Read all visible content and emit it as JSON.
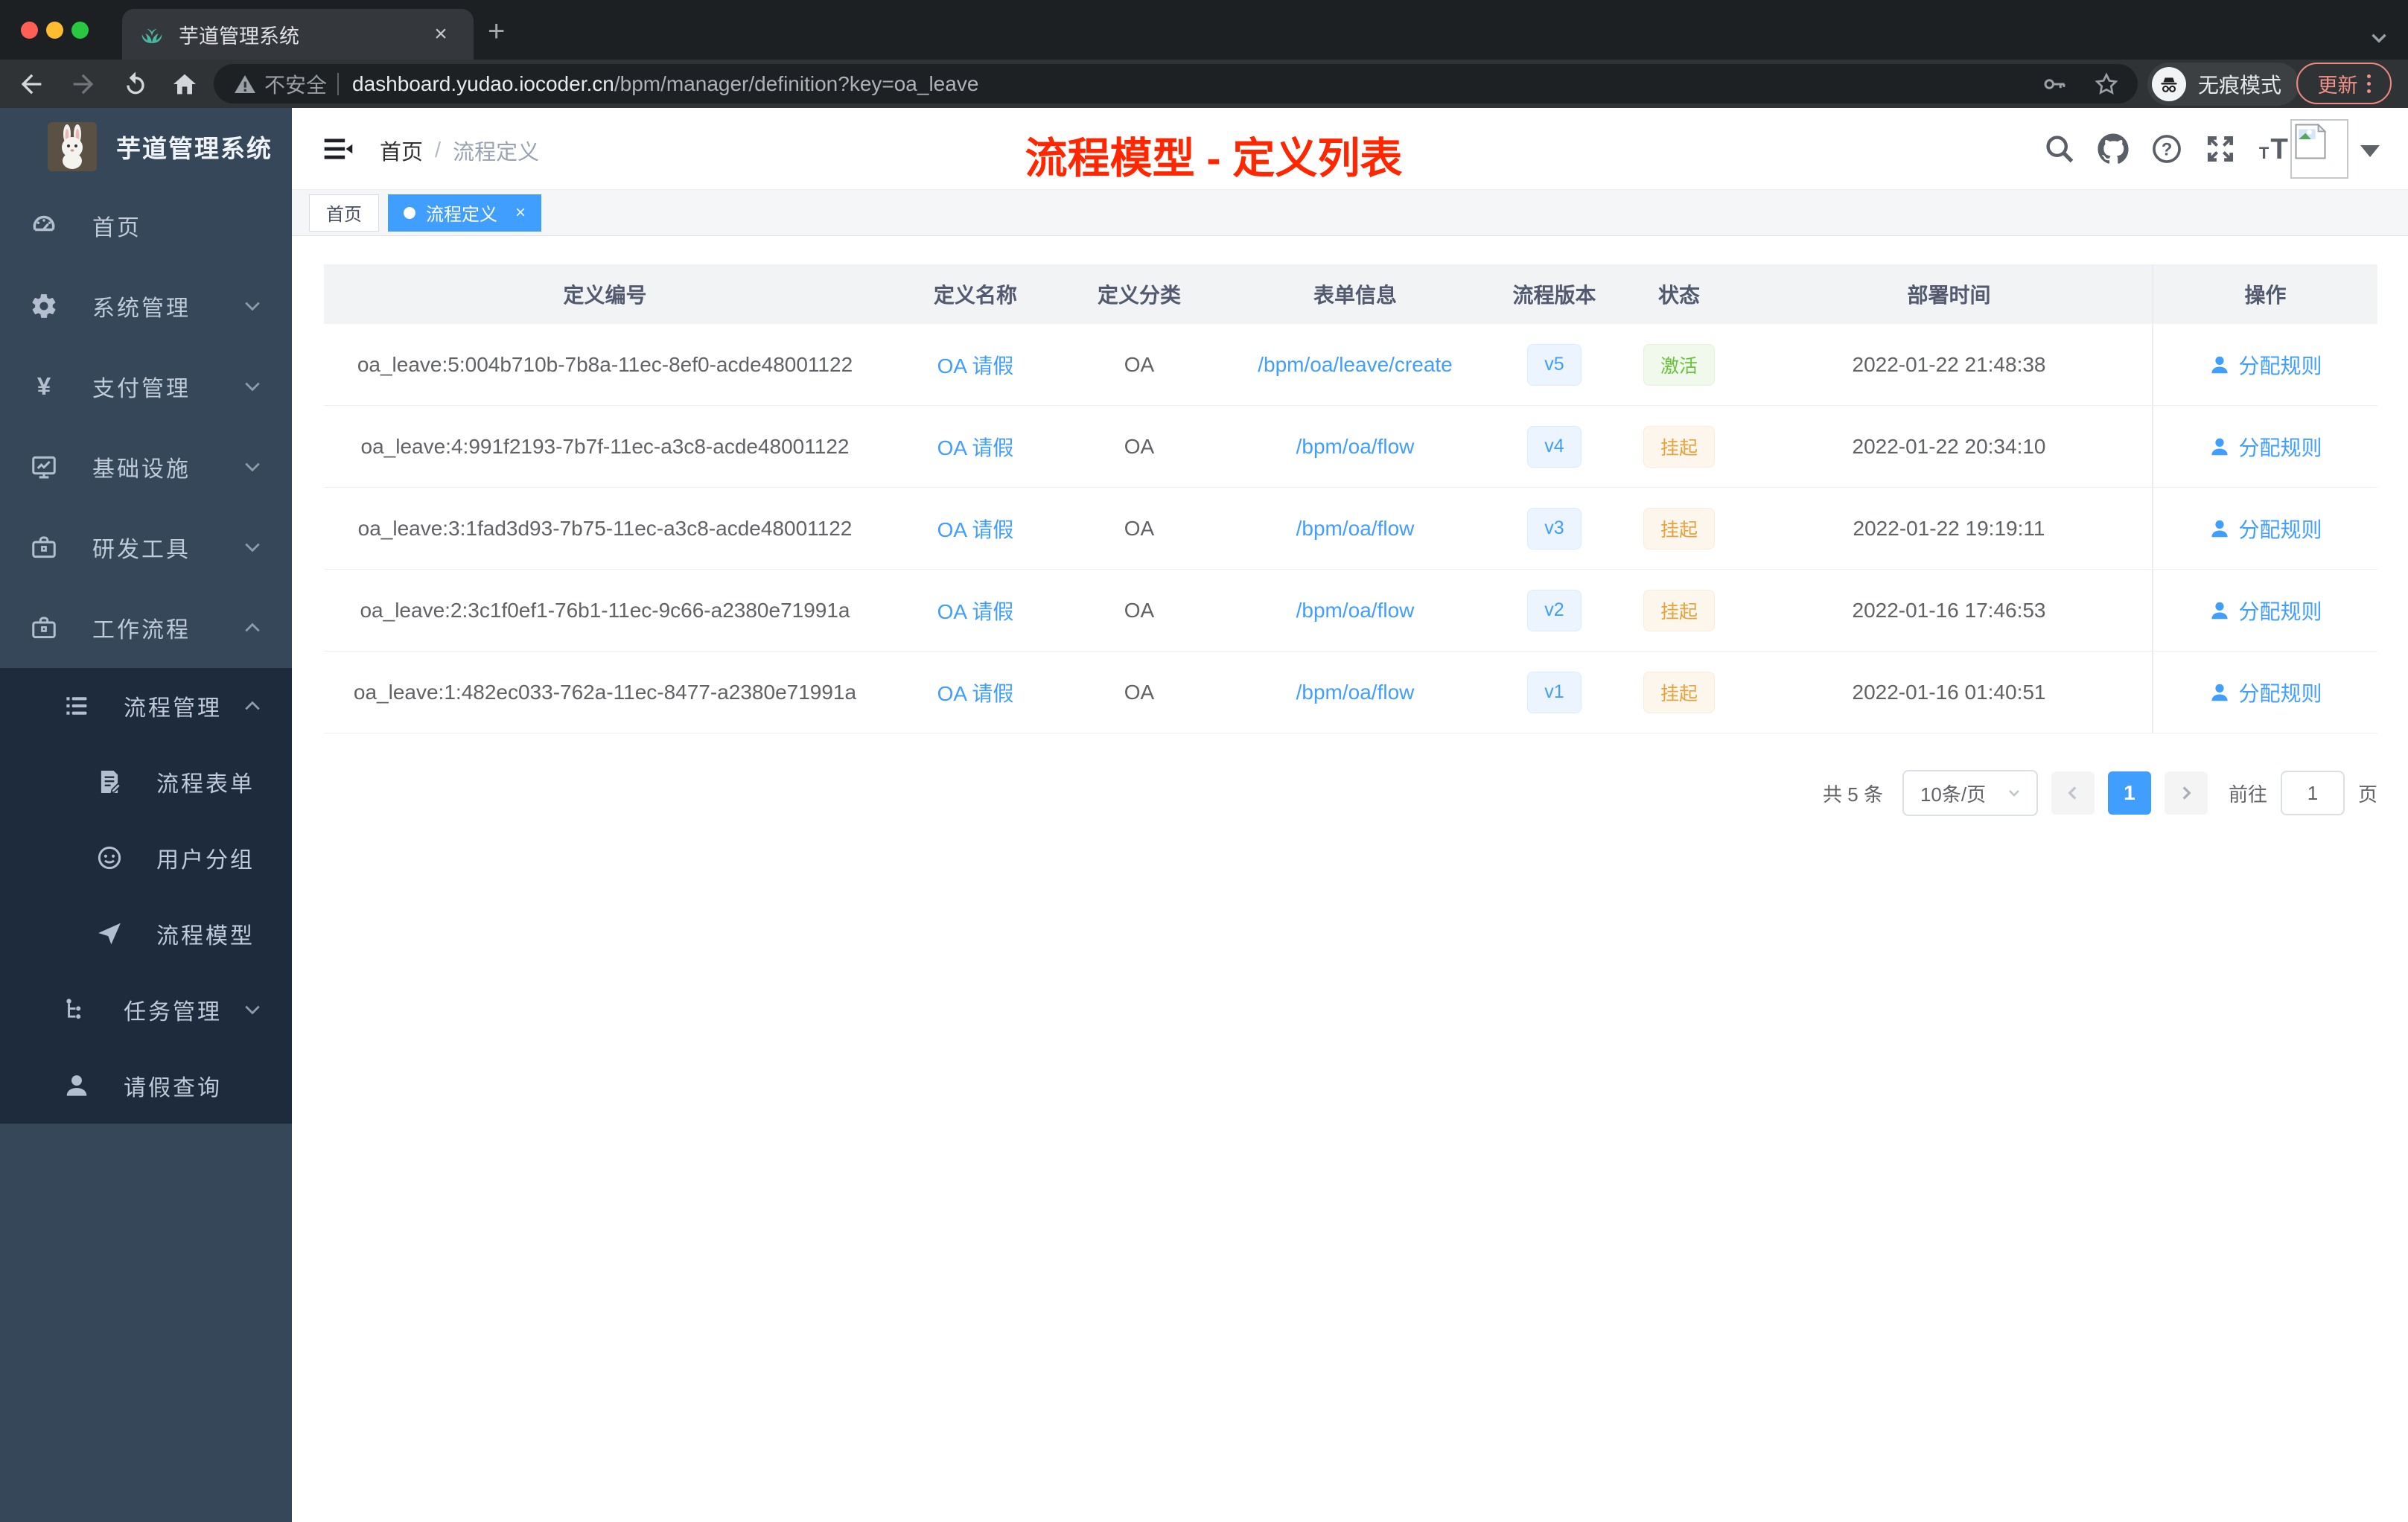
{
  "browser": {
    "tab_title": "芋道管理系统",
    "security_label": "不安全",
    "url_domain": "dashboard.yudao.iocoder.cn",
    "url_path": "/bpm/manager/definition?key=oa_leave",
    "incognito_label": "无痕模式",
    "update_label": "更新"
  },
  "sidebar": {
    "logo_title": "芋道管理系统",
    "items": [
      {
        "key": "home",
        "label": "首页",
        "icon": "dashboard-icon",
        "level": 1,
        "chevron": "",
        "submenu": false
      },
      {
        "key": "system-management",
        "label": "系统管理",
        "icon": "gear-icon",
        "level": 1,
        "chevron": "down",
        "submenu": false
      },
      {
        "key": "payment-management",
        "label": "支付管理",
        "icon": "yen-icon",
        "level": 1,
        "chevron": "down",
        "submenu": false
      },
      {
        "key": "infrastructure",
        "label": "基础设施",
        "icon": "monitor-icon",
        "level": 1,
        "chevron": "down",
        "submenu": false
      },
      {
        "key": "dev-tools",
        "label": "研发工具",
        "icon": "toolbox-icon",
        "level": 1,
        "chevron": "down",
        "submenu": false
      },
      {
        "key": "workflow",
        "label": "工作流程",
        "icon": "toolbox-icon",
        "level": 1,
        "chevron": "up",
        "submenu": false
      },
      {
        "key": "process-management",
        "label": "流程管理",
        "icon": "list-icon",
        "level": 2,
        "chevron": "up",
        "submenu": true
      },
      {
        "key": "process-form",
        "label": "流程表单",
        "icon": "form-icon",
        "level": 3,
        "chevron": "",
        "submenu": true
      },
      {
        "key": "user-group",
        "label": "用户分组",
        "icon": "user-group-icon",
        "level": 3,
        "chevron": "",
        "submenu": true
      },
      {
        "key": "process-model",
        "label": "流程模型",
        "icon": "paper-plane-icon",
        "level": 3,
        "chevron": "",
        "submenu": true
      },
      {
        "key": "task-management",
        "label": "任务管理",
        "icon": "tree-icon",
        "level": 2,
        "chevron": "down",
        "submenu": true
      },
      {
        "key": "leave-query",
        "label": "请假查询",
        "icon": "person-icon",
        "level": 2,
        "chevron": "",
        "submenu": true
      }
    ]
  },
  "navbar": {
    "breadcrumb_home": "首页",
    "breadcrumb_separator": "/",
    "breadcrumb_current": "流程定义",
    "annotation": "流程模型 - 定义列表",
    "icons": [
      {
        "key": "search"
      },
      {
        "key": "github"
      },
      {
        "key": "question"
      },
      {
        "key": "fullscreen"
      },
      {
        "key": "font-size"
      }
    ]
  },
  "tags": [
    {
      "label": "首页",
      "active": false,
      "closable": false
    },
    {
      "label": "流程定义",
      "active": true,
      "closable": true
    }
  ],
  "table": {
    "headers": [
      "定义编号",
      "定义名称",
      "定义分类",
      "表单信息",
      "流程版本",
      "状态",
      "部署时间",
      "操作"
    ],
    "rows": [
      {
        "id": "oa_leave:5:004b710b-7b8a-11ec-8ef0-acde48001122",
        "name": "OA 请假",
        "category": "OA",
        "form": "/bpm/oa/leave/create",
        "version": "v5",
        "status": "激活",
        "status_type": "success",
        "deploy_time": "2022-01-22 21:48:38",
        "action": "分配规则"
      },
      {
        "id": "oa_leave:4:991f2193-7b7f-11ec-a3c8-acde48001122",
        "name": "OA 请假",
        "category": "OA",
        "form": "/bpm/oa/flow",
        "version": "v4",
        "status": "挂起",
        "status_type": "warning",
        "deploy_time": "2022-01-22 20:34:10",
        "action": "分配规则"
      },
      {
        "id": "oa_leave:3:1fad3d93-7b75-11ec-a3c8-acde48001122",
        "name": "OA 请假",
        "category": "OA",
        "form": "/bpm/oa/flow",
        "version": "v3",
        "status": "挂起",
        "status_type": "warning",
        "deploy_time": "2022-01-22 19:19:11",
        "action": "分配规则"
      },
      {
        "id": "oa_leave:2:3c1f0ef1-76b1-11ec-9c66-a2380e71991a",
        "name": "OA 请假",
        "category": "OA",
        "form": "/bpm/oa/flow",
        "version": "v2",
        "status": "挂起",
        "status_type": "warning",
        "deploy_time": "2022-01-16 17:46:53",
        "action": "分配规则"
      },
      {
        "id": "oa_leave:1:482ec033-762a-11ec-8477-a2380e71991a",
        "name": "OA 请假",
        "category": "OA",
        "form": "/bpm/oa/flow",
        "version": "v1",
        "status": "挂起",
        "status_type": "warning",
        "deploy_time": "2022-01-16 01:40:51",
        "action": "分配规则"
      }
    ]
  },
  "pagination": {
    "total": "共 5 条",
    "page_size": "10条/页",
    "current_page": "1",
    "goto_label": "前往",
    "goto_value": "1",
    "page_unit": "页"
  },
  "colors": {
    "accent_blue": "#409eff",
    "success_green": "#67c23a",
    "warning_orange": "#e6a23c",
    "annotation_red": "#ff2600",
    "sidebar_bg": "#37475a",
    "submenu_bg": "#1e2b3c"
  }
}
